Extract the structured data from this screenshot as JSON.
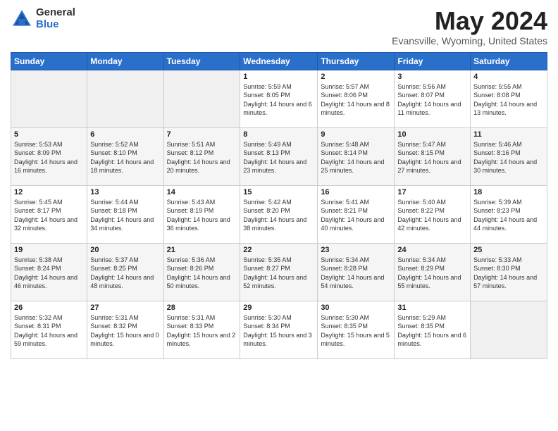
{
  "logo": {
    "general": "General",
    "blue": "Blue"
  },
  "title": "May 2024",
  "location": "Evansville, Wyoming, United States",
  "days_of_week": [
    "Sunday",
    "Monday",
    "Tuesday",
    "Wednesday",
    "Thursday",
    "Friday",
    "Saturday"
  ],
  "weeks": [
    [
      {
        "day": "",
        "sunrise": "",
        "sunset": "",
        "daylight": ""
      },
      {
        "day": "",
        "sunrise": "",
        "sunset": "",
        "daylight": ""
      },
      {
        "day": "",
        "sunrise": "",
        "sunset": "",
        "daylight": ""
      },
      {
        "day": "1",
        "sunrise": "Sunrise: 5:59 AM",
        "sunset": "Sunset: 8:05 PM",
        "daylight": "Daylight: 14 hours and 6 minutes."
      },
      {
        "day": "2",
        "sunrise": "Sunrise: 5:57 AM",
        "sunset": "Sunset: 8:06 PM",
        "daylight": "Daylight: 14 hours and 8 minutes."
      },
      {
        "day": "3",
        "sunrise": "Sunrise: 5:56 AM",
        "sunset": "Sunset: 8:07 PM",
        "daylight": "Daylight: 14 hours and 11 minutes."
      },
      {
        "day": "4",
        "sunrise": "Sunrise: 5:55 AM",
        "sunset": "Sunset: 8:08 PM",
        "daylight": "Daylight: 14 hours and 13 minutes."
      }
    ],
    [
      {
        "day": "5",
        "sunrise": "Sunrise: 5:53 AM",
        "sunset": "Sunset: 8:09 PM",
        "daylight": "Daylight: 14 hours and 16 minutes."
      },
      {
        "day": "6",
        "sunrise": "Sunrise: 5:52 AM",
        "sunset": "Sunset: 8:10 PM",
        "daylight": "Daylight: 14 hours and 18 minutes."
      },
      {
        "day": "7",
        "sunrise": "Sunrise: 5:51 AM",
        "sunset": "Sunset: 8:12 PM",
        "daylight": "Daylight: 14 hours and 20 minutes."
      },
      {
        "day": "8",
        "sunrise": "Sunrise: 5:49 AM",
        "sunset": "Sunset: 8:13 PM",
        "daylight": "Daylight: 14 hours and 23 minutes."
      },
      {
        "day": "9",
        "sunrise": "Sunrise: 5:48 AM",
        "sunset": "Sunset: 8:14 PM",
        "daylight": "Daylight: 14 hours and 25 minutes."
      },
      {
        "day": "10",
        "sunrise": "Sunrise: 5:47 AM",
        "sunset": "Sunset: 8:15 PM",
        "daylight": "Daylight: 14 hours and 27 minutes."
      },
      {
        "day": "11",
        "sunrise": "Sunrise: 5:46 AM",
        "sunset": "Sunset: 8:16 PM",
        "daylight": "Daylight: 14 hours and 30 minutes."
      }
    ],
    [
      {
        "day": "12",
        "sunrise": "Sunrise: 5:45 AM",
        "sunset": "Sunset: 8:17 PM",
        "daylight": "Daylight: 14 hours and 32 minutes."
      },
      {
        "day": "13",
        "sunrise": "Sunrise: 5:44 AM",
        "sunset": "Sunset: 8:18 PM",
        "daylight": "Daylight: 14 hours and 34 minutes."
      },
      {
        "day": "14",
        "sunrise": "Sunrise: 5:43 AM",
        "sunset": "Sunset: 8:19 PM",
        "daylight": "Daylight: 14 hours and 36 minutes."
      },
      {
        "day": "15",
        "sunrise": "Sunrise: 5:42 AM",
        "sunset": "Sunset: 8:20 PM",
        "daylight": "Daylight: 14 hours and 38 minutes."
      },
      {
        "day": "16",
        "sunrise": "Sunrise: 5:41 AM",
        "sunset": "Sunset: 8:21 PM",
        "daylight": "Daylight: 14 hours and 40 minutes."
      },
      {
        "day": "17",
        "sunrise": "Sunrise: 5:40 AM",
        "sunset": "Sunset: 8:22 PM",
        "daylight": "Daylight: 14 hours and 42 minutes."
      },
      {
        "day": "18",
        "sunrise": "Sunrise: 5:39 AM",
        "sunset": "Sunset: 8:23 PM",
        "daylight": "Daylight: 14 hours and 44 minutes."
      }
    ],
    [
      {
        "day": "19",
        "sunrise": "Sunrise: 5:38 AM",
        "sunset": "Sunset: 8:24 PM",
        "daylight": "Daylight: 14 hours and 46 minutes."
      },
      {
        "day": "20",
        "sunrise": "Sunrise: 5:37 AM",
        "sunset": "Sunset: 8:25 PM",
        "daylight": "Daylight: 14 hours and 48 minutes."
      },
      {
        "day": "21",
        "sunrise": "Sunrise: 5:36 AM",
        "sunset": "Sunset: 8:26 PM",
        "daylight": "Daylight: 14 hours and 50 minutes."
      },
      {
        "day": "22",
        "sunrise": "Sunrise: 5:35 AM",
        "sunset": "Sunset: 8:27 PM",
        "daylight": "Daylight: 14 hours and 52 minutes."
      },
      {
        "day": "23",
        "sunrise": "Sunrise: 5:34 AM",
        "sunset": "Sunset: 8:28 PM",
        "daylight": "Daylight: 14 hours and 54 minutes."
      },
      {
        "day": "24",
        "sunrise": "Sunrise: 5:34 AM",
        "sunset": "Sunset: 8:29 PM",
        "daylight": "Daylight: 14 hours and 55 minutes."
      },
      {
        "day": "25",
        "sunrise": "Sunrise: 5:33 AM",
        "sunset": "Sunset: 8:30 PM",
        "daylight": "Daylight: 14 hours and 57 minutes."
      }
    ],
    [
      {
        "day": "26",
        "sunrise": "Sunrise: 5:32 AM",
        "sunset": "Sunset: 8:31 PM",
        "daylight": "Daylight: 14 hours and 59 minutes."
      },
      {
        "day": "27",
        "sunrise": "Sunrise: 5:31 AM",
        "sunset": "Sunset: 8:32 PM",
        "daylight": "Daylight: 15 hours and 0 minutes."
      },
      {
        "day": "28",
        "sunrise": "Sunrise: 5:31 AM",
        "sunset": "Sunset: 8:33 PM",
        "daylight": "Daylight: 15 hours and 2 minutes."
      },
      {
        "day": "29",
        "sunrise": "Sunrise: 5:30 AM",
        "sunset": "Sunset: 8:34 PM",
        "daylight": "Daylight: 15 hours and 3 minutes."
      },
      {
        "day": "30",
        "sunrise": "Sunrise: 5:30 AM",
        "sunset": "Sunset: 8:35 PM",
        "daylight": "Daylight: 15 hours and 5 minutes."
      },
      {
        "day": "31",
        "sunrise": "Sunrise: 5:29 AM",
        "sunset": "Sunset: 8:35 PM",
        "daylight": "Daylight: 15 hours and 6 minutes."
      },
      {
        "day": "",
        "sunrise": "",
        "sunset": "",
        "daylight": ""
      }
    ]
  ]
}
